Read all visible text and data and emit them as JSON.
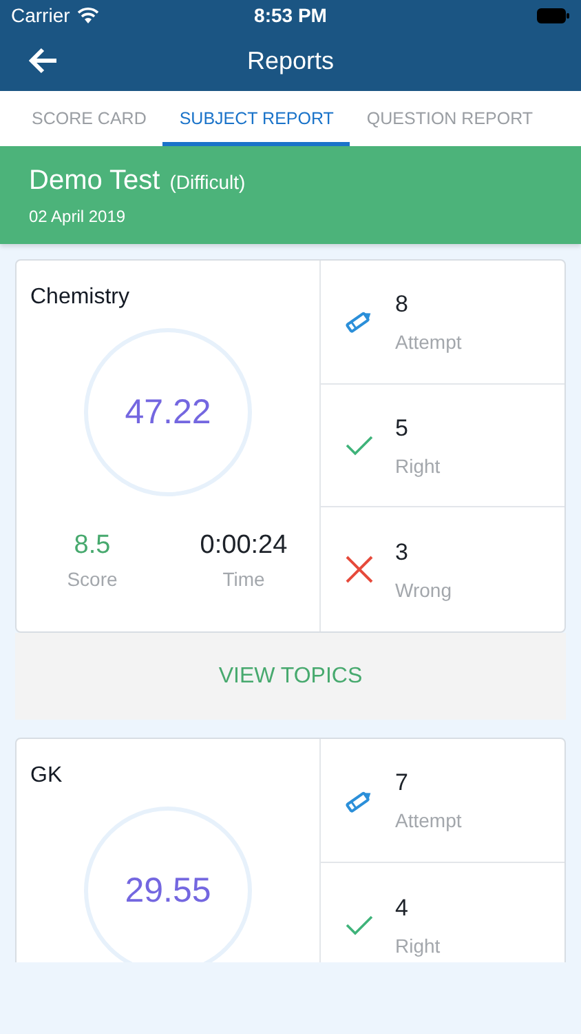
{
  "status_bar": {
    "carrier": "Carrier",
    "time": "8:53 PM"
  },
  "nav": {
    "title": "Reports"
  },
  "tabs": [
    {
      "label": "SCORE CARD",
      "selected": false
    },
    {
      "label": "SUBJECT REPORT",
      "selected": true
    },
    {
      "label": "QUESTION REPORT",
      "selected": false
    }
  ],
  "test": {
    "name": "Demo Test",
    "level": "(Difficult)",
    "date": "02 April 2019"
  },
  "subjects": [
    {
      "name": "Chemistry",
      "percent": "47.22",
      "score": "8.5",
      "score_label": "Score",
      "time": "0:00:24",
      "time_label": "Time",
      "stats": [
        {
          "kind": "attempt",
          "value": "8",
          "label": "Attempt"
        },
        {
          "kind": "right",
          "value": "5",
          "label": "Right"
        },
        {
          "kind": "wrong",
          "value": "3",
          "label": "Wrong"
        }
      ],
      "action": "VIEW TOPICS"
    },
    {
      "name": "GK",
      "percent": "29.55",
      "stats": [
        {
          "kind": "attempt",
          "value": "7",
          "label": "Attempt"
        },
        {
          "kind": "right",
          "value": "4",
          "label": "Right"
        }
      ]
    }
  ]
}
